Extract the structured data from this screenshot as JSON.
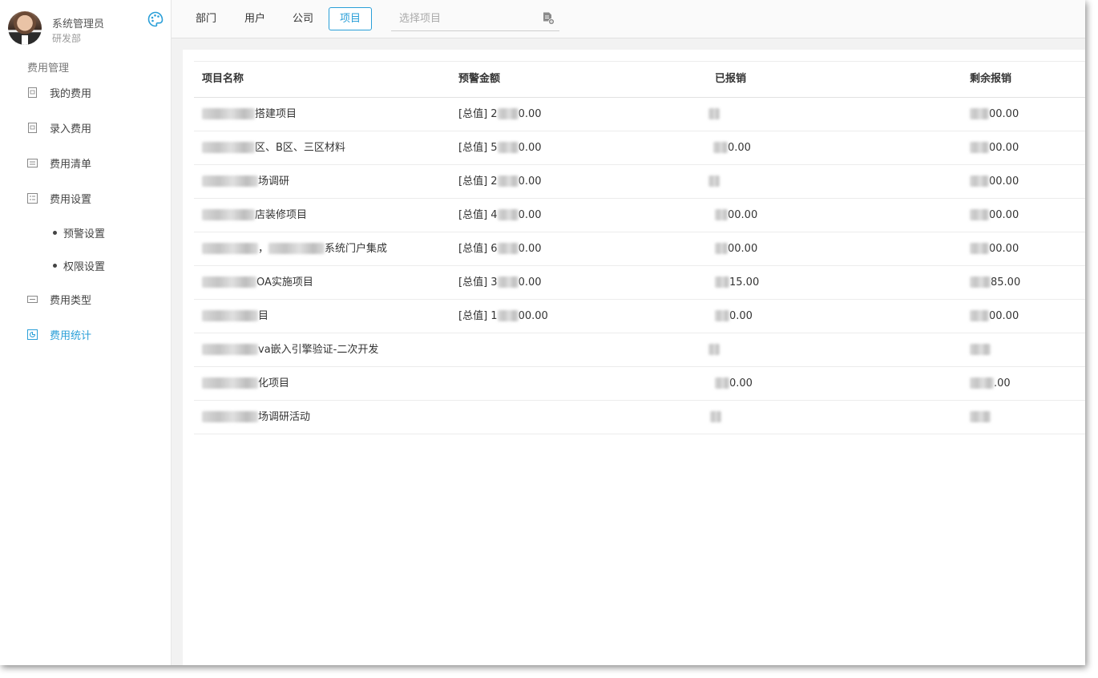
{
  "user": {
    "name": "系统管理员",
    "department": "研发部"
  },
  "sidebar": {
    "section_title": "费用管理",
    "items": [
      {
        "label": "我的费用",
        "icon": "doc-icon"
      },
      {
        "label": "录入费用",
        "icon": "doc-icon"
      },
      {
        "label": "费用清单",
        "icon": "list-icon"
      },
      {
        "label": "费用设置",
        "icon": "settings-list-icon"
      },
      {
        "label": "费用类型",
        "icon": "type-icon"
      },
      {
        "label": "费用统计",
        "icon": "chart-icon",
        "active": true
      }
    ],
    "sub_items": [
      {
        "label": "预警设置"
      },
      {
        "label": "权限设置"
      }
    ]
  },
  "tabs": [
    {
      "label": "部门"
    },
    {
      "label": "用户"
    },
    {
      "label": "公司"
    },
    {
      "label": "项目",
      "active": true
    }
  ],
  "search": {
    "placeholder": "选择项目",
    "value": ""
  },
  "table": {
    "headers": [
      "项目名称",
      "预警金额",
      "已报销",
      "剩余报销"
    ],
    "rows": [
      {
        "name": "搭建项目",
        "warn": "[总值] 2",
        "warn_tail": "0.00",
        "used": "",
        "remain": "00.00"
      },
      {
        "name": "区、B区、三区材料",
        "warn": "[总值] 5",
        "warn_tail": "0.00",
        "used": "0.00",
        "remain": "00.00"
      },
      {
        "name": "场调研",
        "warn": "[总值] 2",
        "warn_tail": "0.00",
        "used": "",
        "remain": "00.00"
      },
      {
        "name": "店装修项目",
        "warn": "[总值] 4",
        "warn_tail": "0.00",
        "used": "00.00",
        "remain": "00.00"
      },
      {
        "name": "，",
        "name_tail": "系统门户集成",
        "warn": "[总值] 6",
        "warn_tail": "0.00",
        "used": "00.00",
        "remain": "00.00"
      },
      {
        "name": "OA实施项目",
        "warn": "[总值] 3",
        "warn_tail": "0.00",
        "used": "15.00",
        "remain": "85.00"
      },
      {
        "name": "目",
        "warn": "[总值] 1",
        "warn_tail": "00.00",
        "used": "0.00",
        "remain": "00.00"
      },
      {
        "name": "va嵌入引擎验证-二次开发",
        "warn": "",
        "warn_tail": "",
        "used": "",
        "remain": ""
      },
      {
        "name": "化项目",
        "warn": "",
        "warn_tail": "",
        "used": "0.00",
        "remain": ".00"
      },
      {
        "name": "场调研活动",
        "warn": "",
        "warn_tail": "",
        "used": "",
        "remain": ""
      }
    ]
  },
  "colors": {
    "accent": "#2a9fd8"
  }
}
